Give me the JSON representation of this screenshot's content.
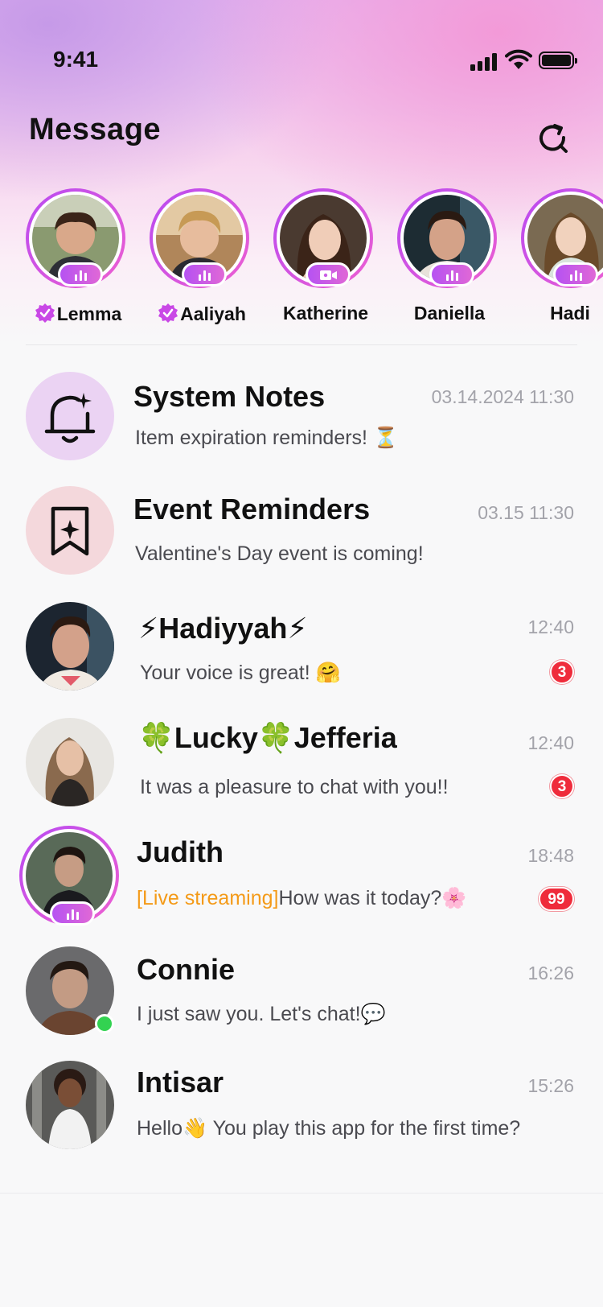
{
  "status_bar": {
    "time": "9:41"
  },
  "header": {
    "title": "Message"
  },
  "stories": [
    {
      "name": "Lemma",
      "verified": true,
      "badge": "audio-live-icon"
    },
    {
      "name": "Aaliyah",
      "verified": true,
      "badge": "audio-live-icon"
    },
    {
      "name": "Katherine",
      "verified": false,
      "badge": "video-live-icon"
    },
    {
      "name": "Daniella",
      "verified": false,
      "badge": "audio-live-icon"
    },
    {
      "name": "Hadi",
      "verified": false,
      "badge": "audio-live-icon"
    }
  ],
  "chats": [
    {
      "name": "System Notes",
      "message": "Item expiration reminders! ⏳",
      "time": "03.14.2024 11:30"
    },
    {
      "name": "Event Reminders",
      "message": "Valentine's Day event is coming!",
      "time": "03.15 11:30"
    },
    {
      "name": "⚡Hadiyyah⚡",
      "message": "Your voice is great! 🤗",
      "time": "12:40",
      "unread": "3"
    },
    {
      "name": "🍀Lucky🍀Jefferia",
      "message": "It was a pleasure to chat with you!!",
      "time": "12:40",
      "unread": "3"
    },
    {
      "name": "Judith",
      "live_prefix": "[Live streaming]",
      "message": "How was it today?🌸",
      "time": "18:48",
      "unread": "99"
    },
    {
      "name": "Connie",
      "message": "I just saw you. Let's chat!💬",
      "time": "16:26",
      "online": true
    },
    {
      "name": "Intisar",
      "message": "Hello👋 You play this app for the first time?",
      "time": "15:26"
    }
  ],
  "colors": {
    "accent": "#c25ff0",
    "badge_red": "#ef2b3b",
    "live_orange": "#f49a18",
    "online_green": "#33d251"
  }
}
